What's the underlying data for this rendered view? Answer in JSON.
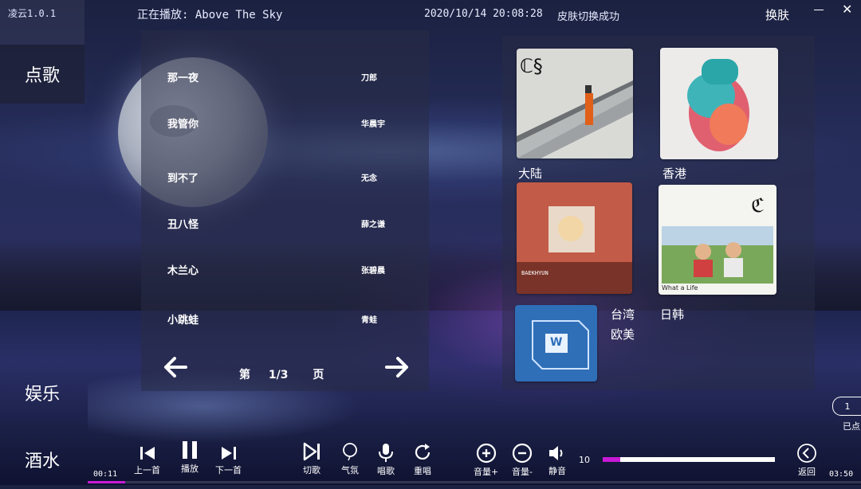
{
  "app": {
    "title": "凌云1.0.1"
  },
  "header": {
    "now_playing": "正在播放: Above The Sky",
    "datetime": "2020/10/14 20:08:28",
    "status": "皮肤切换成功",
    "skin_button": "换肤"
  },
  "nav": {
    "items": [
      {
        "label": "点歌",
        "active": true
      },
      {
        "label": "娱乐",
        "active": false
      },
      {
        "label": "酒水",
        "active": false
      }
    ]
  },
  "songs": [
    {
      "title": "那一夜",
      "artist": "刀郎"
    },
    {
      "title": "我管你",
      "artist": "华晨宇"
    },
    {
      "title": "到不了",
      "artist": "无念"
    },
    {
      "title": "丑八怪",
      "artist": "薛之谦"
    },
    {
      "title": "木兰心",
      "artist": "张碧晨"
    },
    {
      "title": "小跳蛙",
      "artist": "青蛙"
    }
  ],
  "pager": {
    "prefix": "第",
    "value": "1/3",
    "suffix": "页"
  },
  "categories": [
    {
      "label": "大陆",
      "cover_text": ""
    },
    {
      "label": "香港",
      "cover_text": ""
    },
    {
      "label": "台湾",
      "cover_text": "BAEKHYUN"
    },
    {
      "label": "日韩",
      "cover_text": "What a Life"
    },
    {
      "label": "欧美",
      "cover_text": "W"
    }
  ],
  "queue": {
    "count": "1",
    "label": "已点"
  },
  "controls": {
    "prev": "上一首",
    "play": "播放",
    "next": "下一首",
    "cut": "切歌",
    "ambience": "气氛",
    "sing": "唱歌",
    "replay": "重唱",
    "vol_up": "音量+",
    "vol_down": "音量-",
    "mute": "静音",
    "back": "返回"
  },
  "playback": {
    "elapsed": "00:11",
    "duration": "03:50",
    "progress": 0.048
  },
  "volume": {
    "value": "10",
    "level": 0.1
  },
  "colors": {
    "accent": "#c81ad6"
  }
}
